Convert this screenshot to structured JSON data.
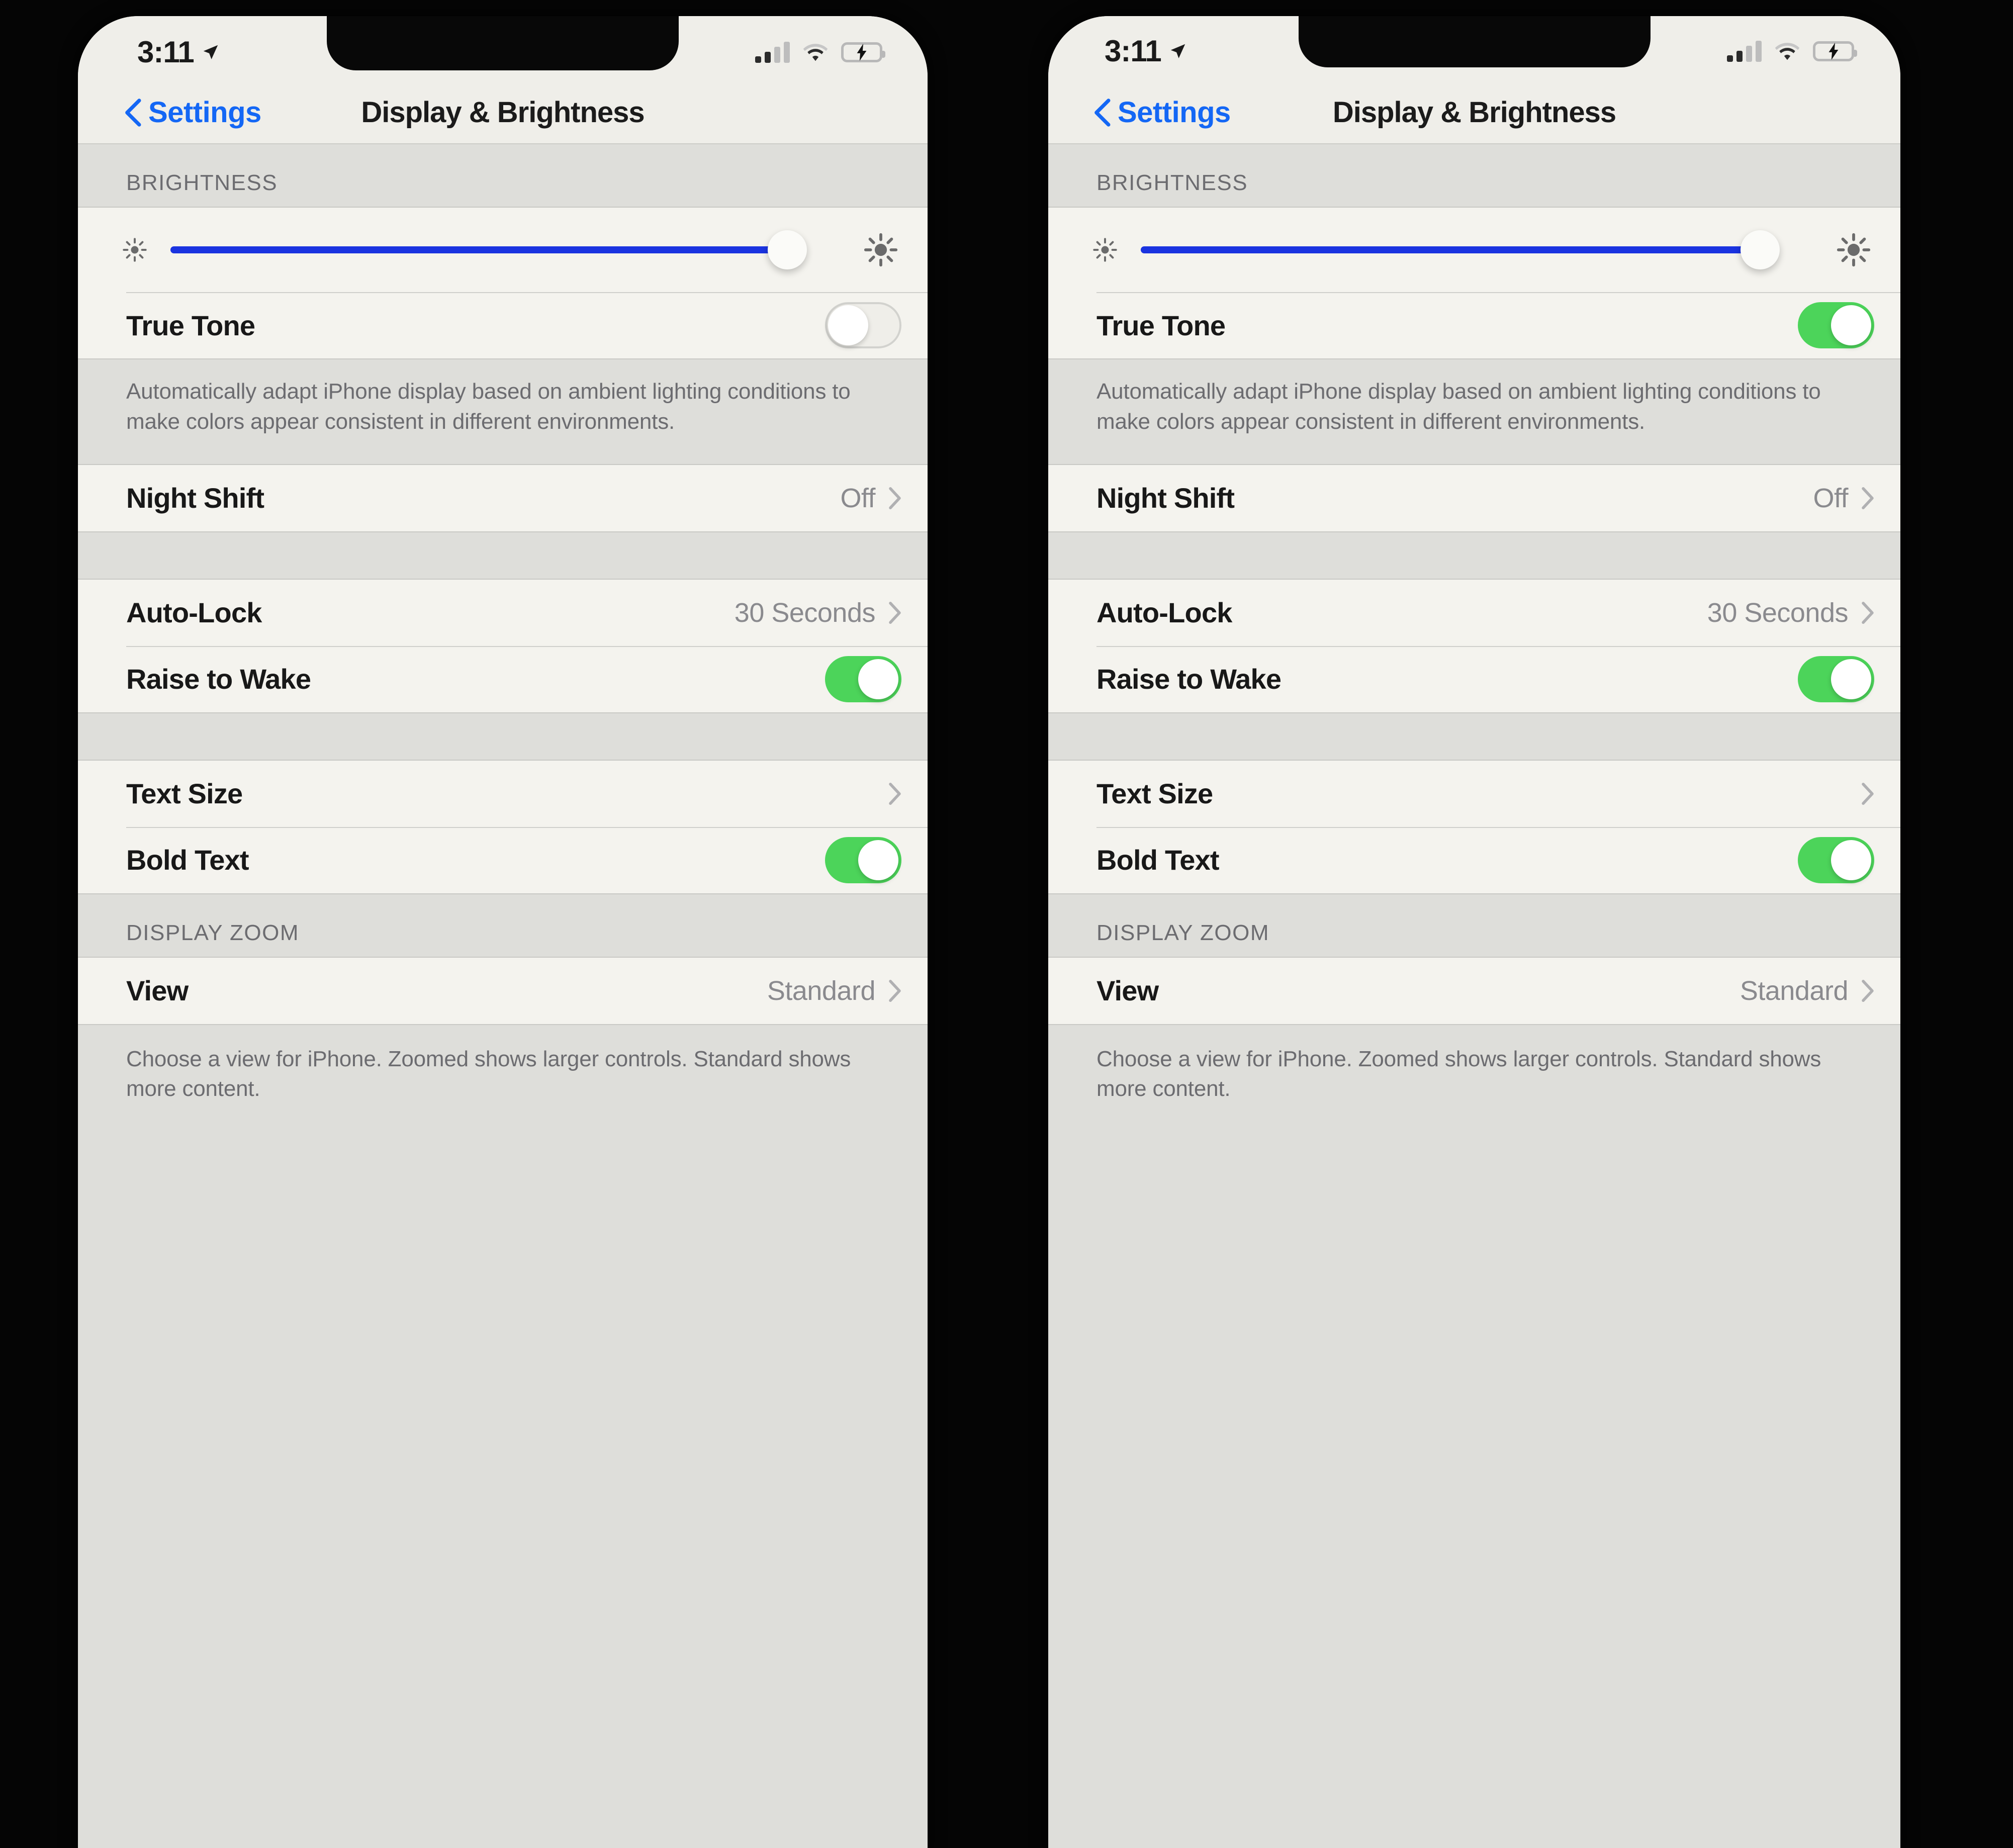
{
  "phones": [
    {
      "id": "phone-left",
      "status_bar": {
        "time": "3:11",
        "location_icon": "location-arrow-icon",
        "signal_icon": "cellular-signal-icon",
        "signal_bars_filled": 2,
        "signal_bars_total": 4,
        "wifi_icon": "wifi-icon",
        "battery_icon": "battery-charging-icon",
        "battery_charging": true,
        "battery_color": "#4cd45a"
      },
      "nav": {
        "back_label": "Settings",
        "back_icon": "chevron-left-icon",
        "title": "Display & Brightness",
        "accent_color": "#1467f5"
      },
      "sections": {
        "brightness_header": "BRIGHTNESS",
        "brightness_slider": {
          "min_icon": "brightness-low-icon",
          "max_icon": "brightness-high-icon",
          "value_percent": 92,
          "track_color": "#1a33e0"
        },
        "true_tone": {
          "label": "True Tone",
          "on": false
        },
        "true_tone_footnote": "Automatically adapt iPhone display based on ambient lighting conditions to make colors appear consistent in different environments.",
        "night_shift": {
          "label": "Night Shift",
          "value": "Off"
        },
        "auto_lock": {
          "label": "Auto-Lock",
          "value": "30 Seconds"
        },
        "raise_to_wake": {
          "label": "Raise to Wake",
          "on": true
        },
        "text_size": {
          "label": "Text Size",
          "value": ""
        },
        "bold_text": {
          "label": "Bold Text",
          "on": true
        },
        "display_zoom_header": "DISPLAY ZOOM",
        "view": {
          "label": "View",
          "value": "Standard"
        },
        "view_footnote": "Choose a view for iPhone. Zoomed shows larger controls. Standard shows more content."
      }
    },
    {
      "id": "phone-right",
      "status_bar": {
        "time": "3:11",
        "location_icon": "location-arrow-icon",
        "signal_icon": "cellular-signal-icon",
        "signal_bars_filled": 2,
        "signal_bars_total": 4,
        "wifi_icon": "wifi-icon",
        "battery_icon": "battery-charging-icon",
        "battery_charging": true,
        "battery_color": "#4cd45a"
      },
      "nav": {
        "back_label": "Settings",
        "back_icon": "chevron-left-icon",
        "title": "Display & Brightness",
        "accent_color": "#1467f5"
      },
      "sections": {
        "brightness_header": "BRIGHTNESS",
        "brightness_slider": {
          "min_icon": "brightness-low-icon",
          "max_icon": "brightness-high-icon",
          "value_percent": 92,
          "track_color": "#1a33e0"
        },
        "true_tone": {
          "label": "True Tone",
          "on": true
        },
        "true_tone_footnote": "Automatically adapt iPhone display based on ambient lighting conditions to make colors appear consistent in different environments.",
        "night_shift": {
          "label": "Night Shift",
          "value": "Off"
        },
        "auto_lock": {
          "label": "Auto-Lock",
          "value": "30 Seconds"
        },
        "raise_to_wake": {
          "label": "Raise to Wake",
          "on": true
        },
        "text_size": {
          "label": "Text Size",
          "value": ""
        },
        "bold_text": {
          "label": "Bold Text",
          "on": true
        },
        "display_zoom_header": "DISPLAY ZOOM",
        "view": {
          "label": "View",
          "value": "Standard"
        },
        "view_footnote": "Choose a view for iPhone. Zoomed shows larger controls. Standard shows more content."
      }
    }
  ]
}
